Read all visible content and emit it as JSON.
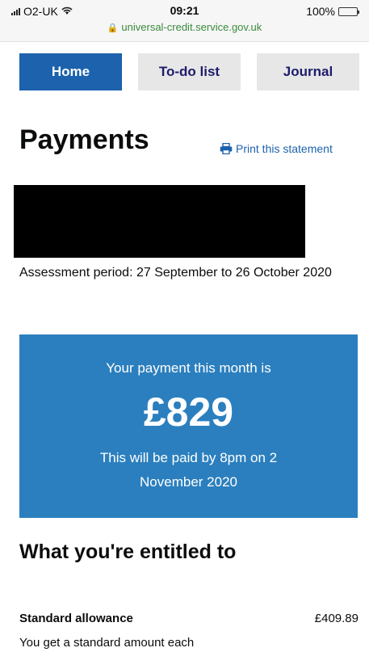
{
  "status_bar": {
    "carrier": "O2-UK",
    "time": "09:21",
    "battery": "100%",
    "battery_level": 1.0,
    "url": "universal-credit.service.gov.uk"
  },
  "tabs": [
    {
      "label": "Home",
      "active": true
    },
    {
      "label": "To-do list",
      "active": false
    },
    {
      "label": "Journal",
      "active": false
    }
  ],
  "page": {
    "title": "Payments",
    "print_link": "Print this statement",
    "assessment_period": "Assessment period: 27 September to 26 October 2020"
  },
  "payment": {
    "caption": "Your payment this month is",
    "amount": "£829",
    "paid_by": "This will be paid by 8pm on 2 November 2020"
  },
  "entitled": {
    "heading": "What you're entitled to",
    "items": [
      {
        "label": "Standard allowance",
        "amount": "£409.89",
        "description": "You get a standard amount each"
      }
    ]
  },
  "colors": {
    "primary_blue": "#1d62ad",
    "payment_blue": "#2b7fbe",
    "tab_grey": "#e7e7e8",
    "url_green": "#3b8a3b"
  }
}
